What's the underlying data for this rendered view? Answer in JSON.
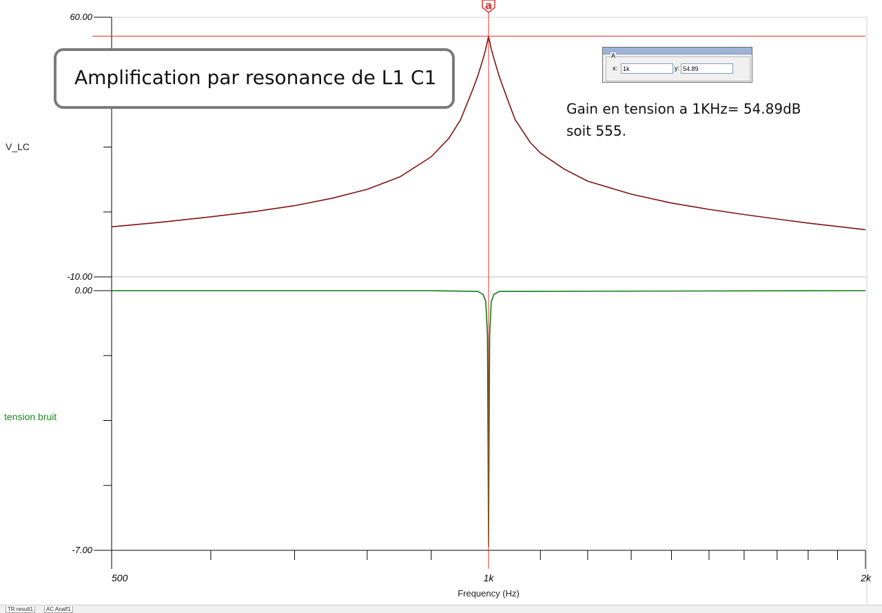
{
  "chart_data": [
    {
      "type": "line",
      "ylabel": "V_LC",
      "ylim": [
        -10,
        60
      ],
      "yticks": [
        "60.00",
        "-10.00"
      ],
      "xscale": "log",
      "xlim": [
        500,
        2000
      ],
      "color": "#7f1010",
      "series": [
        {
          "name": "V_LC",
          "x": [
            500,
            550,
            600,
            650,
            700,
            750,
            800,
            850,
            900,
            930,
            950,
            970,
            980,
            990,
            995,
            1000,
            1005,
            1010,
            1020,
            1030,
            1050,
            1080,
            1100,
            1150,
            1200,
            1300,
            1400,
            1500,
            1600,
            1700,
            1800,
            1900,
            2000
          ],
          "y": [
            3.5,
            4.8,
            6.2,
            7.6,
            9.2,
            11.2,
            13.6,
            17.0,
            22.4,
            27.4,
            32.4,
            40.0,
            44.0,
            48.8,
            51.5,
            54.89,
            51.5,
            48.8,
            44.0,
            40.0,
            32.4,
            26.2,
            23.4,
            19.0,
            15.8,
            12.3,
            9.9,
            8.2,
            6.8,
            5.6,
            4.5,
            3.6,
            2.7
          ]
        }
      ],
      "reference_line": 54.89
    },
    {
      "type": "line",
      "ylabel": "tension bruit",
      "ylim": [
        -7,
        0
      ],
      "yticks": [
        "0.00",
        "-7.00"
      ],
      "xscale": "log",
      "xlim": [
        500,
        2000
      ],
      "color": "#0f7a0f",
      "xticks": [
        "500",
        "1k",
        "2k"
      ],
      "xlabel": "Frequency (Hz)",
      "series": [
        {
          "name": "tension bruit",
          "x": [
            500,
            900,
            980,
            990,
            995,
            998,
            1000,
            1002,
            1005,
            1010,
            1020,
            2000
          ],
          "y": [
            0,
            0,
            -0.02,
            -0.1,
            -0.3,
            -1.2,
            -6.9,
            -1.2,
            -0.3,
            -0.1,
            -0.02,
            0
          ]
        }
      ]
    }
  ],
  "cursor": {
    "marker_label": "a",
    "group_label": "A",
    "x_label": "x:",
    "x_value": "1k",
    "y_label": "y:",
    "y_value": "54.89",
    "color": "#e03030"
  },
  "annotations": {
    "box_text": "Amplification par resonance de L1 C1",
    "gain_line1": "Gain en tension a 1KHz= 54.89dB",
    "gain_line2": "soit 555."
  },
  "tabs": [
    "TR result1",
    "AC Analf1"
  ]
}
